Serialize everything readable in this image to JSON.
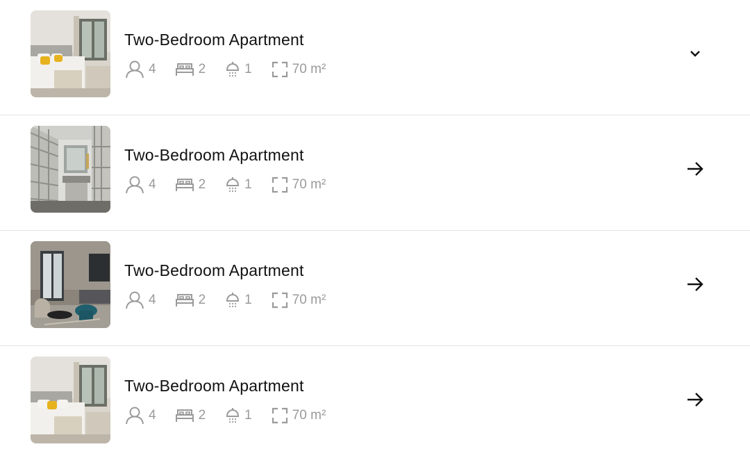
{
  "rooms": [
    {
      "title": "Two-Bedroom Apartment",
      "guests": "4",
      "beds": "2",
      "baths": "1",
      "area": "70 m²",
      "photo": "bedroom-yellow-pillows",
      "action": "chevron-down-icon"
    },
    {
      "title": "Two-Bedroom Apartment",
      "guests": "4",
      "beds": "2",
      "baths": "1",
      "area": "70 m²",
      "photo": "bathroom-mirror",
      "action": "arrow-right-icon"
    },
    {
      "title": "Two-Bedroom Apartment",
      "guests": "4",
      "beds": "2",
      "baths": "1",
      "area": "70 m²",
      "photo": "living-room-window",
      "action": "arrow-right-icon"
    },
    {
      "title": "Two-Bedroom Apartment",
      "guests": "4",
      "beds": "2",
      "baths": "1",
      "area": "70 m²",
      "photo": "bedroom-yellow-pillows",
      "action": "arrow-right-icon"
    }
  ],
  "colors": {
    "title": "#111111",
    "meta": "#9a9a9a",
    "divider": "#e1e1e1",
    "accent_pillow": "#e6b21e"
  }
}
